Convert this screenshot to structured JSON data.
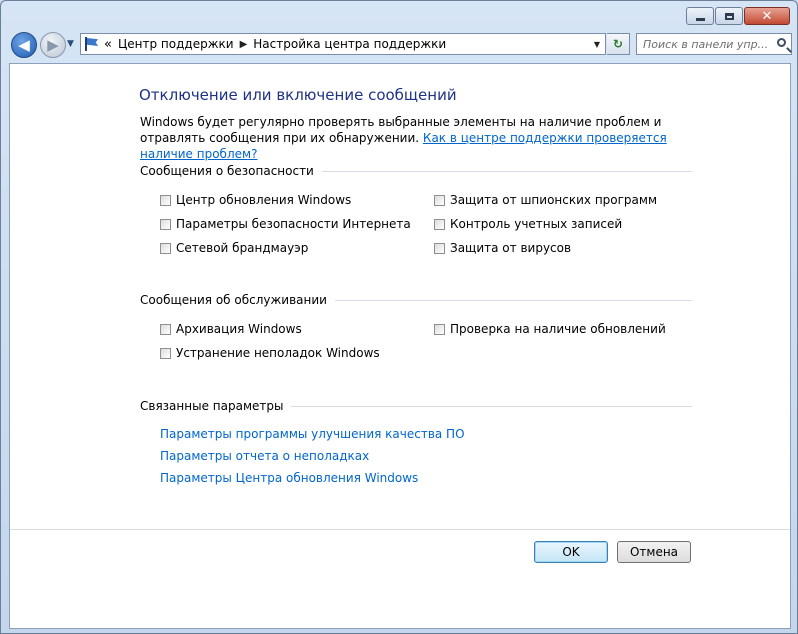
{
  "window": {
    "minimize_label": "",
    "maximize_label": "",
    "close_label": "✕"
  },
  "nav": {
    "back_glyph": "◀",
    "forward_glyph": "▶",
    "recent_glyph": "▼",
    "address_prefix": "«",
    "breadcrumb": [
      "Центр поддержки",
      "Настройка центра поддержки"
    ],
    "breadcrumb_sep": "▶",
    "dropdown_glyph": "▼",
    "refresh_glyph": "↻",
    "search_placeholder": "Поиск в панели упр..."
  },
  "page": {
    "title": "Отключение или включение сообщений",
    "description": "Windows будет регулярно проверять выбранные элементы на наличие проблем и отравлять сообщения при их обнаружении.",
    "description_link": "Как в центре поддержки проверяется наличие проблем?"
  },
  "security": {
    "heading": "Сообщения о безопасности",
    "items": [
      {
        "label": "Центр обновления Windows",
        "checked": false
      },
      {
        "label": "Параметры безопасности Интернета",
        "checked": false
      },
      {
        "label": "Сетевой брандмауэр",
        "checked": false
      },
      {
        "label": "Защита от шпионских программ",
        "checked": false
      },
      {
        "label": "Контроль учетных записей",
        "checked": false
      },
      {
        "label": "Защита от вирусов",
        "checked": false
      }
    ]
  },
  "maintenance": {
    "heading": "Сообщения об обслуживании",
    "items": [
      {
        "label": "Архивация Windows",
        "checked": false
      },
      {
        "label": "Устранение неполадок Windows",
        "checked": false
      },
      {
        "label": "Проверка на наличие обновлений",
        "checked": false
      }
    ]
  },
  "related": {
    "heading": "Связанные параметры",
    "links": [
      "Параметры программы улучшения качества ПО",
      "Параметры отчета о неполадках",
      "Параметры Центра обновления Windows"
    ]
  },
  "buttons": {
    "ok": "OK",
    "cancel": "Отмена"
  },
  "colors": {
    "title": "#1e3287",
    "link": "#0066cc",
    "chrome": "#c5d8ec"
  }
}
